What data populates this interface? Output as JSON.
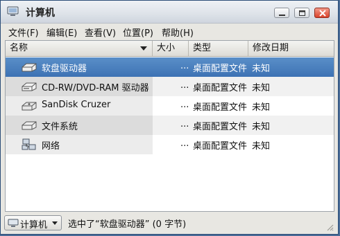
{
  "window": {
    "title": "计算机"
  },
  "menubar": {
    "items": [
      {
        "label": "文件(F)"
      },
      {
        "label": "编辑(E)"
      },
      {
        "label": "查看(V)"
      },
      {
        "label": "位置(P)"
      },
      {
        "label": "帮助(H)"
      }
    ]
  },
  "columns": {
    "name": "名称",
    "size": "大小",
    "type": "类型",
    "date": "修改日期"
  },
  "rows": [
    {
      "name": "软盘驱动器",
      "size": "...",
      "type": "桌面配置文件",
      "date": "未知",
      "icon": "floppy-drive-icon"
    },
    {
      "name": "CD-RW/DVD-RAM 驱动器",
      "size": "...",
      "type": "桌面配置文件",
      "date": "未知",
      "icon": "cdrom-drive-icon"
    },
    {
      "name": "SanDisk Cruzer",
      "size": "...",
      "type": "桌面配置文件",
      "date": "未知",
      "icon": "usb-drive-icon"
    },
    {
      "name": "文件系统",
      "size": "...",
      "type": "桌面配置文件",
      "date": "未知",
      "icon": "filesystem-drive-icon"
    },
    {
      "name": "网络",
      "size": "...",
      "type": "桌面配置文件",
      "date": "未知",
      "icon": "network-icon"
    }
  ],
  "statusbar": {
    "location_label": "计算机",
    "status": "选中了“软盘驱动器” (0 字节)"
  },
  "colors": {
    "selection": "#3d72b4",
    "window_bg": "#e8e7e2"
  }
}
